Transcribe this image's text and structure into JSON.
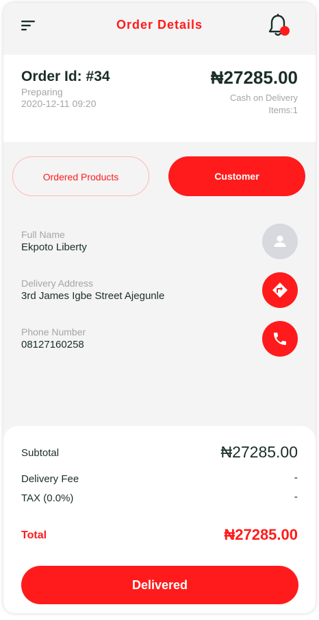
{
  "header": {
    "title": "Order Details",
    "menu_icon": "menu-icon",
    "notification_icon": "bell-icon"
  },
  "order": {
    "id": "Order Id: #34",
    "status": "Preparing",
    "datetime": "2020-12-11 09:20",
    "total": "₦27285.00",
    "payment_method": "Cash on Delivery",
    "items": "Items:1"
  },
  "tabs": {
    "products": "Ordered Products",
    "customer": "Customer",
    "active": "customer"
  },
  "customer": {
    "name_label": "Full Name",
    "name": "Ekpoto Liberty",
    "address_label": "Delivery Address",
    "address": "3rd James Igbe Street Ajegunle",
    "phone_label": "Phone Number",
    "phone": "08127160258"
  },
  "summary": {
    "subtotal_label": "Subtotal",
    "subtotal": "₦27285.00",
    "delivery_label": "Delivery Fee",
    "delivery": "-",
    "tax_label": "TAX (0.0%)",
    "tax": "-",
    "total_label": "Total",
    "total": "₦27285.00"
  },
  "action": {
    "delivered": "Delivered"
  },
  "colors": {
    "accent": "#ff1b1b",
    "text_dark": "#1a2e26",
    "text_muted": "#a5a5a5",
    "background": "#f4f4f4"
  }
}
